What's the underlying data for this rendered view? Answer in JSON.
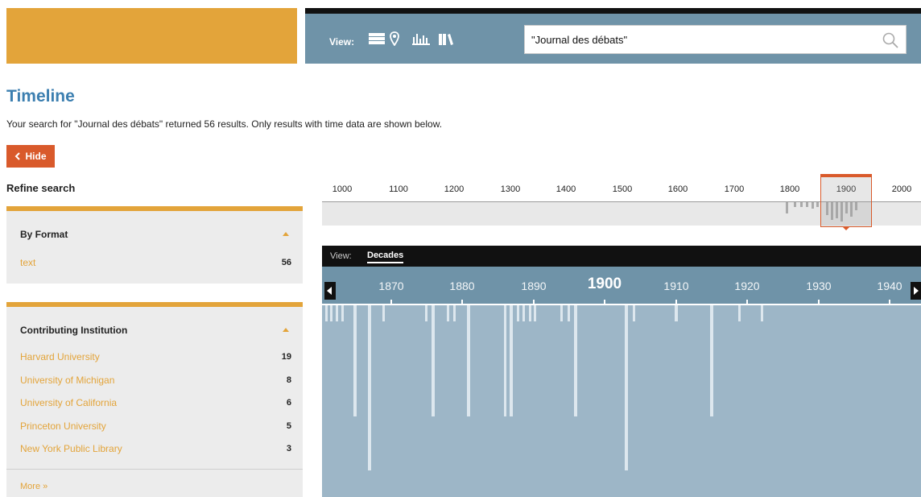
{
  "header": {
    "view_label": "View:",
    "view_icons": [
      "list-view-icon",
      "map-view-icon",
      "timeline-view-icon",
      "bookshelf-view-icon"
    ],
    "search": {
      "value": "\"Journal des débats\"",
      "icon": "search-icon"
    }
  },
  "page": {
    "title": "Timeline",
    "result_text": "Your search for \"Journal des débats\" returned 56 results. Only results with time data are shown below.",
    "hide_label": "Hide",
    "refine_title": "Refine search"
  },
  "facets": {
    "format": {
      "heading": "By Format",
      "items": [
        {
          "label": "text",
          "count": "56"
        }
      ]
    },
    "institution": {
      "heading": "Contributing Institution",
      "items": [
        {
          "label": "Harvard University",
          "count": "19"
        },
        {
          "label": "University of Michigan",
          "count": "8"
        },
        {
          "label": "University of California",
          "count": "6"
        },
        {
          "label": "Princeton University",
          "count": "5"
        },
        {
          "label": "New York Public Library",
          "count": "3"
        }
      ],
      "more_label": "More »"
    }
  },
  "overview": {
    "labels": [
      "1000",
      "1100",
      "1200",
      "1300",
      "1400",
      "1500",
      "1600",
      "1700",
      "1800",
      "1900",
      "2000"
    ],
    "selected": "1900"
  },
  "detail": {
    "view_label": "View:",
    "mode": "Decades",
    "labels": [
      "1870",
      "1880",
      "1890",
      "1900",
      "1910",
      "1920",
      "1930",
      "1940"
    ],
    "major": "1900"
  },
  "colors": {
    "accent_orange": "#e3a43a",
    "header_blue": "#6f93a8",
    "button_red": "#d95a2b",
    "title_blue": "#3c7fb0"
  }
}
